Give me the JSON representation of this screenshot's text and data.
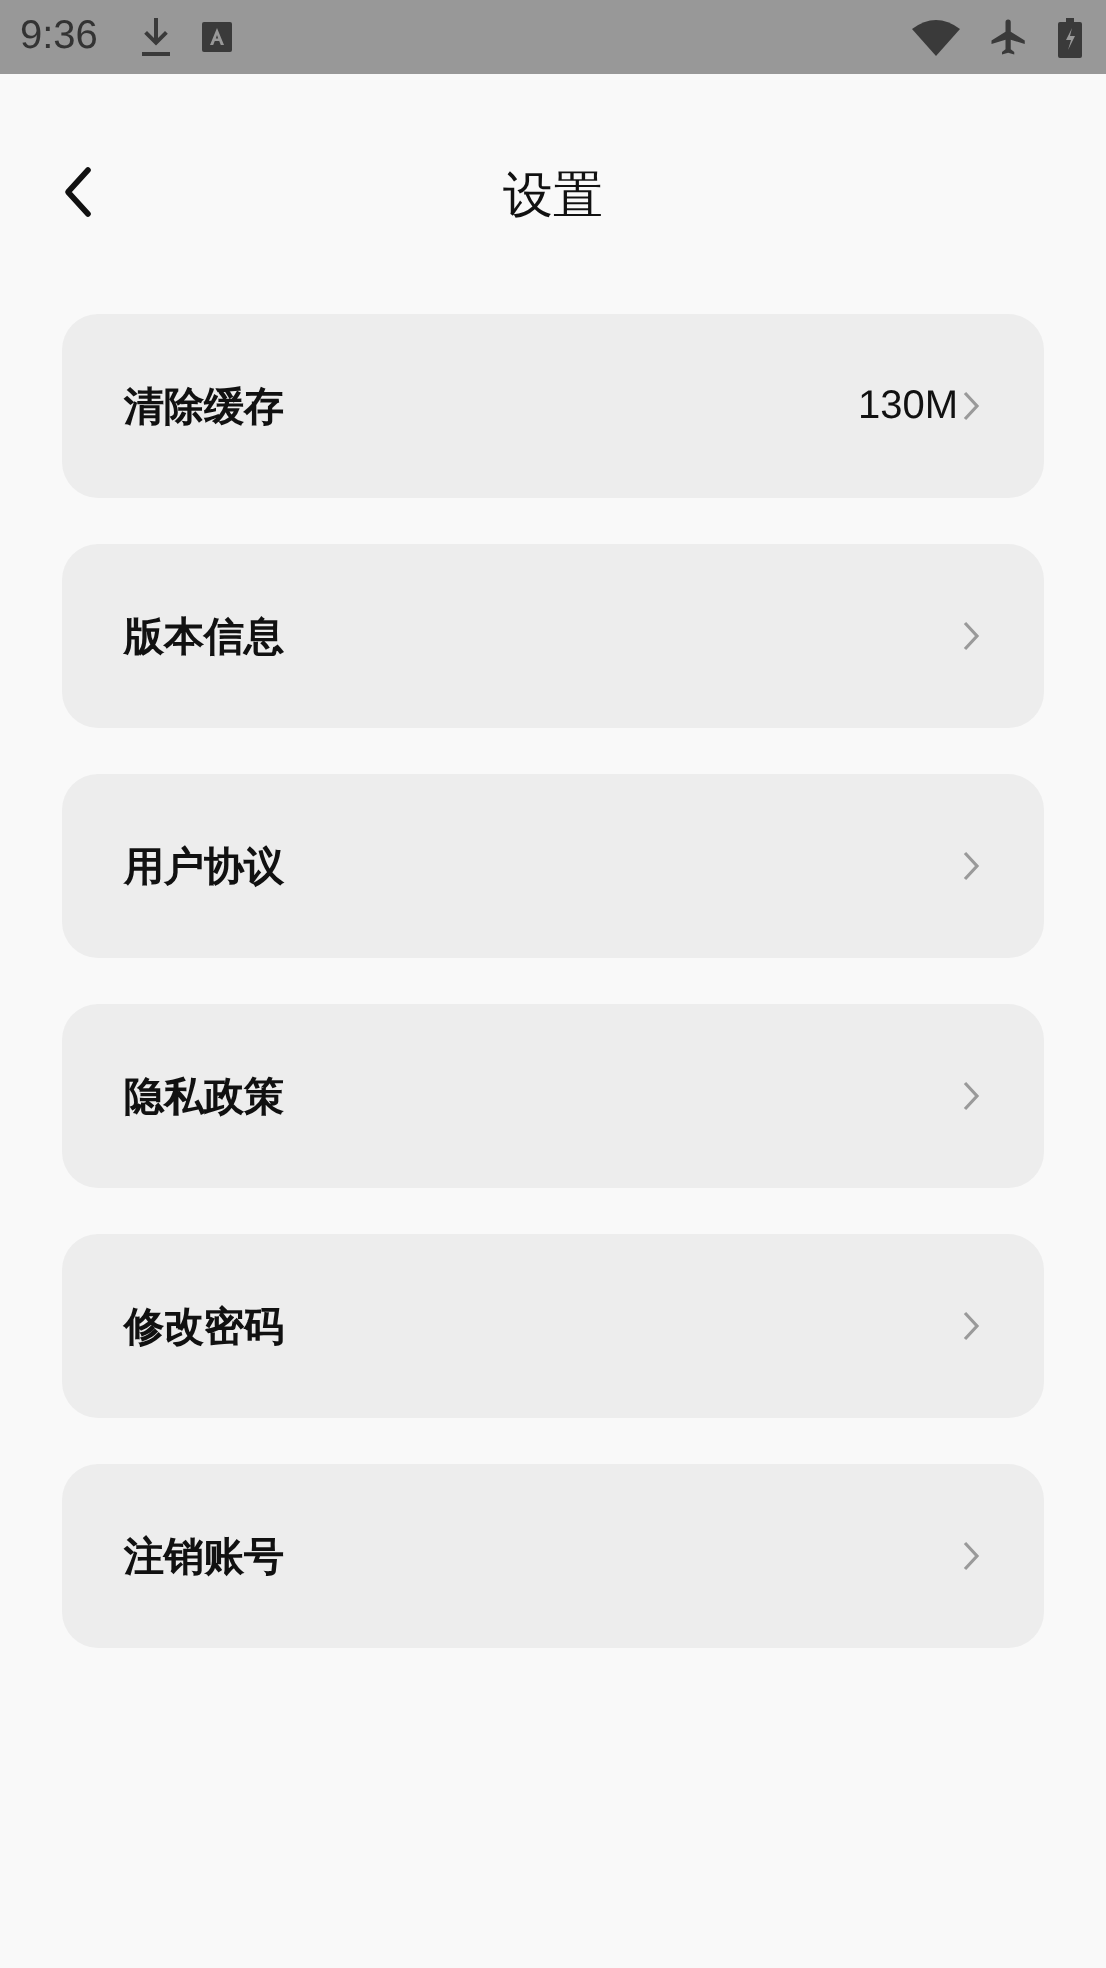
{
  "status_bar": {
    "time": "9:36"
  },
  "header": {
    "title": "设置"
  },
  "items": [
    {
      "label": "清除缓存",
      "value": "130M"
    },
    {
      "label": "版本信息"
    },
    {
      "label": "用户协议"
    },
    {
      "label": "隐私政策"
    },
    {
      "label": "修改密码"
    },
    {
      "label": "注销账号"
    }
  ]
}
